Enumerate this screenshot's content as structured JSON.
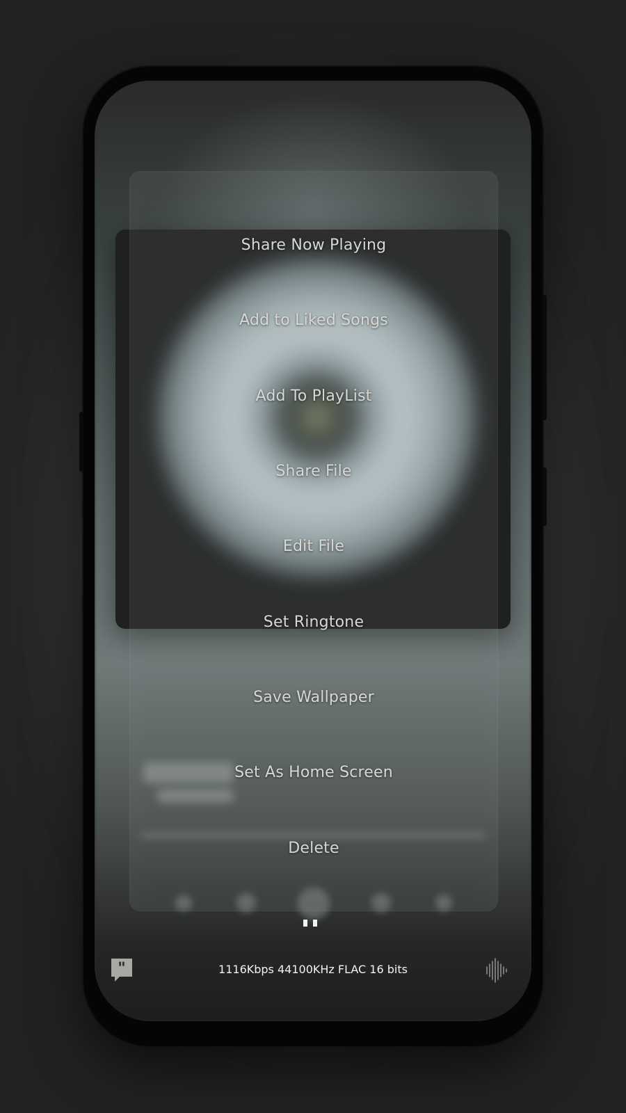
{
  "menu": {
    "items": [
      {
        "label": "Share Now Playing"
      },
      {
        "label": "Add to Liked Songs"
      },
      {
        "label": "Add To PlayList"
      },
      {
        "label": "Share File"
      },
      {
        "label": "Edit File"
      },
      {
        "label": "Set Ringtone"
      },
      {
        "label": "Save Wallpaper"
      },
      {
        "label": "Set As Home Screen"
      },
      {
        "label": "Delete"
      }
    ]
  },
  "player": {
    "audio_info": "1116Kbps 44100KHz FLAC 16 bits",
    "left_icon": "quote-bubble-icon",
    "right_icon": "waveform-icon",
    "play_state_icon": "pause-icon"
  },
  "colors": {
    "background": "#232323",
    "menu_text": "#d8d8d4",
    "info_text": "#f3f3f0"
  }
}
